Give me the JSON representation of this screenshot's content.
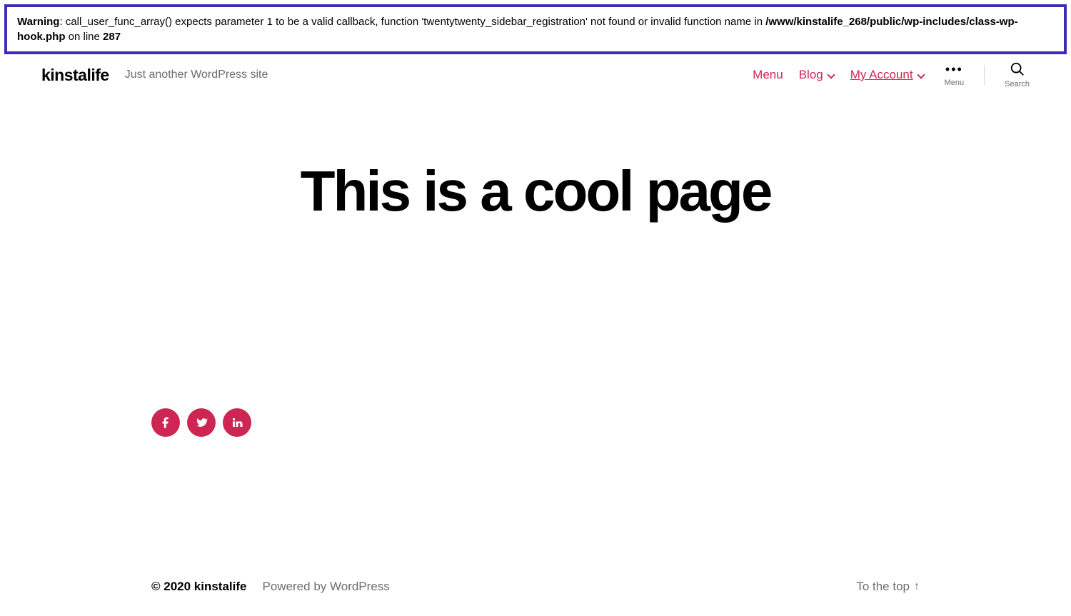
{
  "warning": {
    "label": "Warning",
    "msg1": ": call_user_func_array() expects parameter 1 to be a valid callback, function 'twentytwenty_sidebar_registration' not found or invalid function name in ",
    "path": "/www/kinstalife_268/public/wp-includes/class-wp-hook.php",
    "on_line": " on line ",
    "line_no": "287"
  },
  "header": {
    "site_title": "kinstalife",
    "tagline": "Just another WordPress site",
    "nav": {
      "menu": "Menu",
      "blog": "Blog",
      "account": "My Account"
    },
    "menu_label": "Menu",
    "search_label": "Search"
  },
  "page": {
    "title": "This is a cool page"
  },
  "social": {
    "facebook": "facebook-icon",
    "twitter": "twitter-icon",
    "linkedin": "linkedin-icon"
  },
  "footer": {
    "copyright": "© 2020 kinstalife",
    "powered": "Powered by WordPress",
    "totop": "To the top"
  }
}
